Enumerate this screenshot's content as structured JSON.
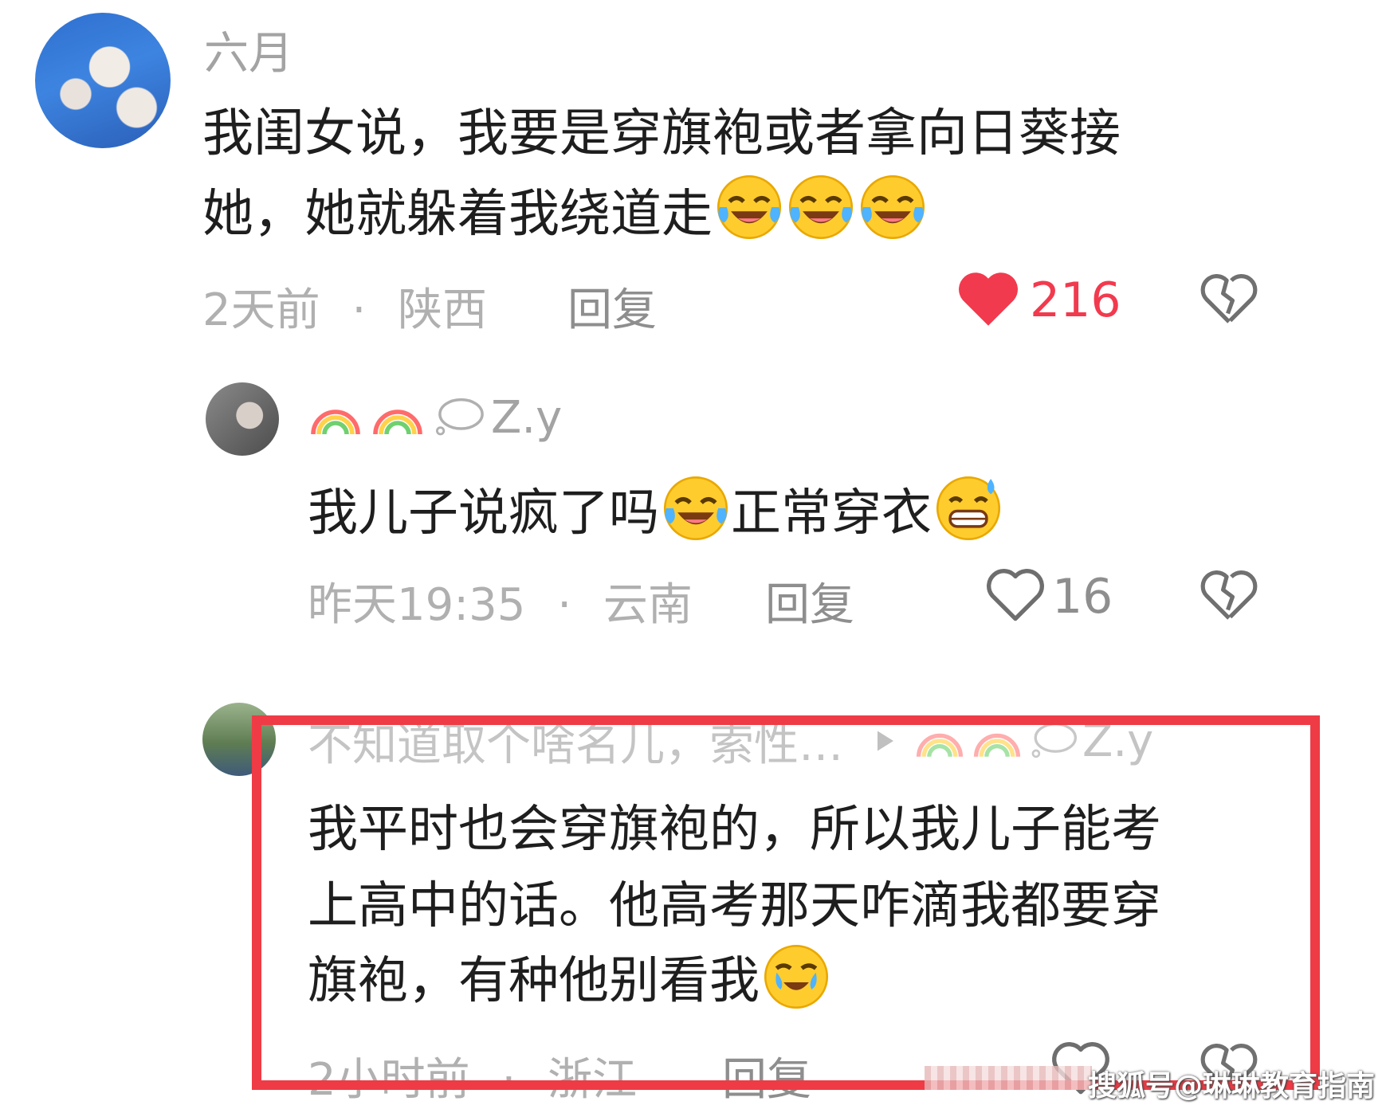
{
  "comments": [
    {
      "username": "六月",
      "text_line1": "我闺女说，我要是穿旗袍或者拿向日葵接",
      "text_line2": "她，她就躲着我绕道走",
      "emojis": [
        "laugh-cry-icon",
        "laugh-cry-icon",
        "laugh-cry-icon"
      ],
      "time": "2天前",
      "sep": "·",
      "location": "陕西",
      "reply_label": "回复",
      "like_count": "216",
      "liked": true
    },
    {
      "username": "Z.y",
      "username_prefix_icons": [
        "rainbow-icon",
        "rainbow-icon",
        "thought-bubble-icon"
      ],
      "text_a": "我儿子说疯了吗",
      "text_b": "正常穿衣",
      "time": "昨天19:35",
      "sep": "·",
      "location": "云南",
      "reply_label": "回复",
      "like_count": "16",
      "liked": false
    },
    {
      "username": "不知道取个啥名儿，索性…",
      "reply_to": "Z.y",
      "text_line1": "我平时也会穿旗袍的，所以我儿子能考",
      "text_line2": "上高中的话。他高考那天咋滴我都要穿",
      "text_line3": "旗袍，有种他别看我",
      "time": "2小时前",
      "sep": "·",
      "location": "浙江",
      "reply_label": "回复"
    }
  ],
  "watermark": "搜狐号@琳琳教育指南",
  "colors": {
    "like_red": "#f23a4e",
    "highlight_border": "#ef3b45"
  }
}
